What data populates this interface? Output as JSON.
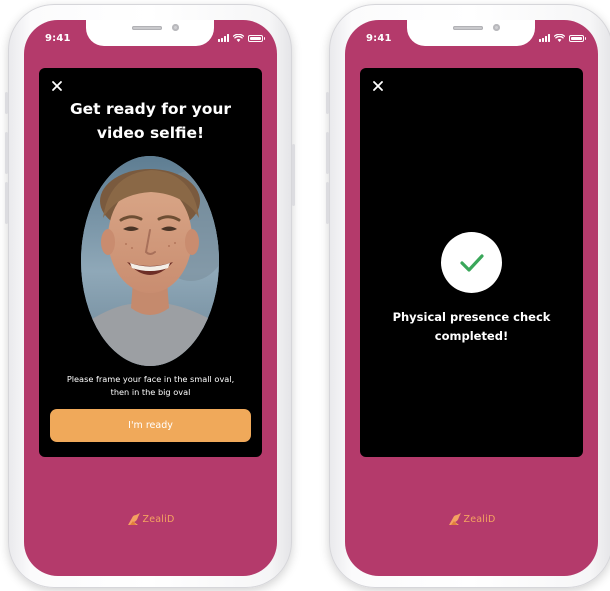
{
  "screens": [
    {
      "status_time": "9:41",
      "title": "Get ready for your video selfie!",
      "instruction": "Please frame your face in the small oval, then in the big oval",
      "button_label": "I'm ready",
      "brand": "ZealiD"
    },
    {
      "status_time": "9:41",
      "message": "Physical presence check completed!",
      "brand": "ZealiD"
    }
  ],
  "colors": {
    "screen_background": "#b43a6b",
    "card_background": "#000000",
    "button": "#f0a95a",
    "brand": "#f4a261",
    "check": "#3aa75a"
  },
  "icons": {
    "close": "close-icon",
    "check": "checkmark-icon",
    "brand": "zealid-logo-icon",
    "wifi": "wifi-icon",
    "signal": "signal-icon",
    "battery": "battery-icon"
  }
}
